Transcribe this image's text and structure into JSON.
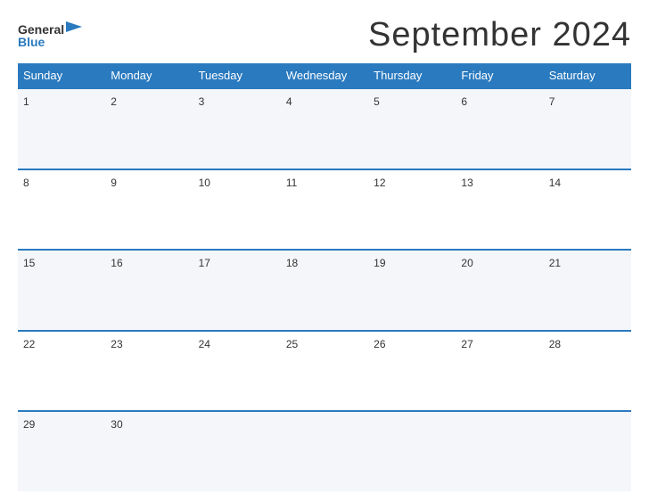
{
  "header": {
    "logo": {
      "general": "General",
      "blue": "Blue"
    },
    "title": "September 2024"
  },
  "days": [
    "Sunday",
    "Monday",
    "Tuesday",
    "Wednesday",
    "Thursday",
    "Friday",
    "Saturday"
  ],
  "weeks": [
    [
      {
        "num": "1",
        "empty": false
      },
      {
        "num": "2",
        "empty": false
      },
      {
        "num": "3",
        "empty": false
      },
      {
        "num": "4",
        "empty": false
      },
      {
        "num": "5",
        "empty": false
      },
      {
        "num": "6",
        "empty": false
      },
      {
        "num": "7",
        "empty": false
      }
    ],
    [
      {
        "num": "8",
        "empty": false
      },
      {
        "num": "9",
        "empty": false
      },
      {
        "num": "10",
        "empty": false
      },
      {
        "num": "11",
        "empty": false
      },
      {
        "num": "12",
        "empty": false
      },
      {
        "num": "13",
        "empty": false
      },
      {
        "num": "14",
        "empty": false
      }
    ],
    [
      {
        "num": "15",
        "empty": false
      },
      {
        "num": "16",
        "empty": false
      },
      {
        "num": "17",
        "empty": false
      },
      {
        "num": "18",
        "empty": false
      },
      {
        "num": "19",
        "empty": false
      },
      {
        "num": "20",
        "empty": false
      },
      {
        "num": "21",
        "empty": false
      }
    ],
    [
      {
        "num": "22",
        "empty": false
      },
      {
        "num": "23",
        "empty": false
      },
      {
        "num": "24",
        "empty": false
      },
      {
        "num": "25",
        "empty": false
      },
      {
        "num": "26",
        "empty": false
      },
      {
        "num": "27",
        "empty": false
      },
      {
        "num": "28",
        "empty": false
      }
    ],
    [
      {
        "num": "29",
        "empty": false
      },
      {
        "num": "30",
        "empty": false
      },
      {
        "num": "",
        "empty": true
      },
      {
        "num": "",
        "empty": true
      },
      {
        "num": "",
        "empty": true
      },
      {
        "num": "",
        "empty": true
      },
      {
        "num": "",
        "empty": true
      }
    ]
  ]
}
